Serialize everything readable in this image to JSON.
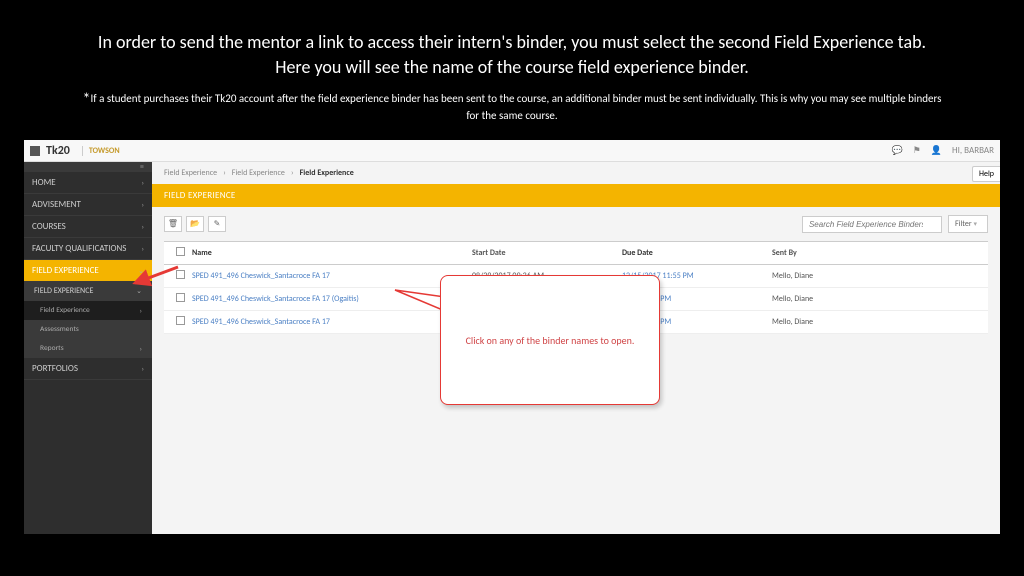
{
  "slide": {
    "text": "In order to send the mentor a link to access their intern's binder, you must select the second Field Experience tab.  Here you will see the name of the course field experience binder.",
    "note": "If a student purchases their Tk20 account after the field experience binder has been sent to the course, an additional binder must be sent individually. This is why you may see multiple binders for the same course."
  },
  "topbar": {
    "logo": "Tk20",
    "towson": "TOWSON",
    "user_greeting": "HI, BARBAR",
    "help": "Help"
  },
  "sidebar": {
    "items": [
      {
        "label": "HOME"
      },
      {
        "label": "ADVISEMENT"
      },
      {
        "label": "COURSES"
      },
      {
        "label": "FACULTY QUALIFICATIONS"
      },
      {
        "label": "FIELD EXPERIENCE",
        "active": true
      },
      {
        "label": "PORTFOLIOS"
      }
    ],
    "fe_subs": [
      {
        "label": "FIELD EXPERIENCE"
      },
      {
        "label": "Field Experience",
        "hl": true
      },
      {
        "label": "Assessments"
      },
      {
        "label": "Reports"
      }
    ]
  },
  "breadcrumb": [
    "Field Experience",
    "Field Experience",
    "Field Experience"
  ],
  "banner": "FIELD EXPERIENCE",
  "search": {
    "placeholder": "Search Field Experience Binders",
    "filter": "Filter"
  },
  "table": {
    "headers": {
      "name": "Name",
      "start": "Start Date",
      "due": "Due Date",
      "sent": "Sent By"
    },
    "rows": [
      {
        "name": "SPED 491_496 Cheswick_Santacroce FA 17",
        "start": "08/29/2017 09:36 AM",
        "due": "12/15/2017 11:55 PM",
        "sent": "Mello, Diane"
      },
      {
        "name": "SPED 491_496 Cheswick_Santacroce FA 17 (Ogaitis)",
        "start": "",
        "due": "2017 11:55 PM",
        "sent": "Mello, Diane"
      },
      {
        "name": "SPED 491_496 Cheswick_Santacroce FA 17",
        "start": "",
        "due": "2017 11:55 PM",
        "sent": "Mello, Diane"
      }
    ]
  },
  "callout": "Click on any of the binder names to open."
}
